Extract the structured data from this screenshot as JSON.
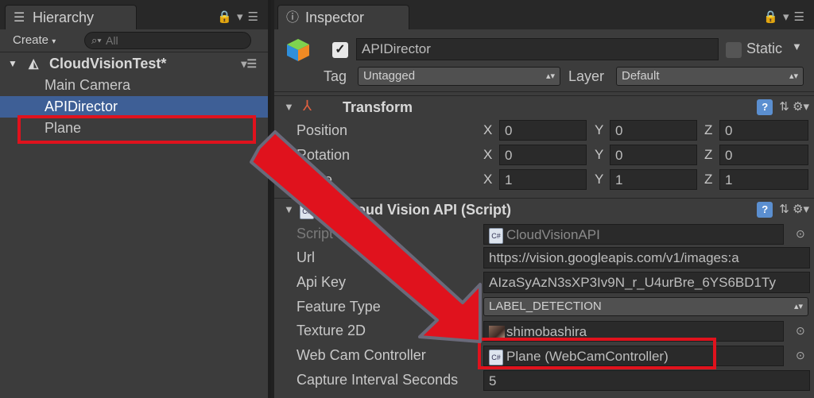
{
  "hierarchy": {
    "tab_label": "Hierarchy",
    "create_label": "Create",
    "search_placeholder": "All",
    "scene": "CloudVisionTest*",
    "items": [
      "Main Camera",
      "APIDirector",
      "Plane"
    ],
    "selected_index": 1
  },
  "inspector": {
    "tab_label": "Inspector",
    "object_name": "APIDirector",
    "static_label": "Static",
    "tag_label": "Tag",
    "tag_value": "Untagged",
    "layer_label": "Layer",
    "layer_value": "Default",
    "transform": {
      "title": "Transform",
      "rows": [
        {
          "label": "Position",
          "x": "0",
          "y": "0",
          "z": "0"
        },
        {
          "label": "Rotation",
          "x": "0",
          "y": "0",
          "z": "0"
        },
        {
          "label": "Scale",
          "x": "1",
          "y": "1",
          "z": "1"
        }
      ],
      "axes": [
        "X",
        "Y",
        "Z"
      ]
    },
    "script_component": {
      "title": "Cloud Vision API (Script)",
      "script_label": "Script",
      "script_value": "CloudVisionAPI",
      "url_label": "Url",
      "url_value": "https://vision.googleapis.com/v1/images:a",
      "api_key_label": "Api Key",
      "api_key_value": "AIzaSyAzN3sXP3Iv9N_r_U4urBre_6YS6BD1Ty",
      "feature_type_label": "Feature Type",
      "feature_type_value": "LABEL_DETECTION",
      "texture_label": "Texture 2D",
      "texture_value": "shimobashira",
      "webcam_label": "Web Cam Controller",
      "webcam_value": "Plane (WebCamController)",
      "capture_label": "Capture Interval Seconds",
      "capture_value": "5"
    }
  },
  "colors": {
    "selection": "#3e5f96",
    "highlight_red": "#e0121d"
  }
}
